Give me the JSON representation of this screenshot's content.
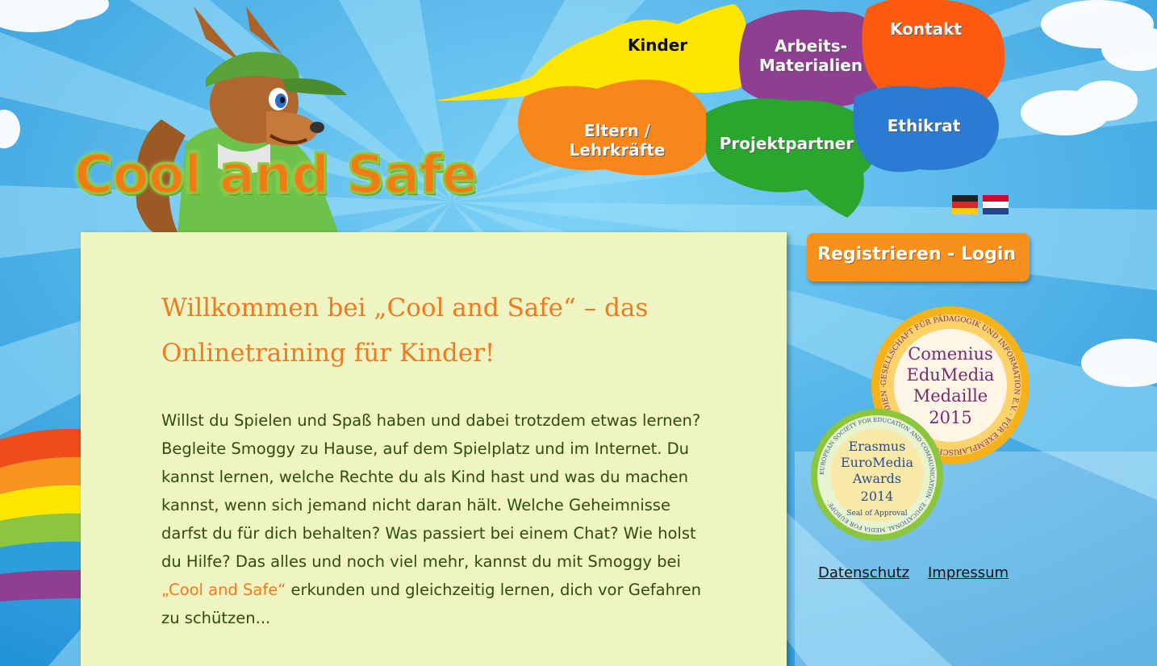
{
  "header": {
    "logo_text": "Cool and Safe"
  },
  "nav": {
    "kinder": "Kinder",
    "arbeitsmaterialien_line1": "Arbeits-",
    "arbeitsmaterialien_line2": "Materialien",
    "kontakt": "Kontakt",
    "eltern_line1": "Eltern /",
    "eltern_line2": "Lehrkräfte",
    "projektpartner": "Projektpartner",
    "ethikrat": "Ethikrat"
  },
  "main": {
    "title": "Willkommen bei „Cool and Safe“ – das Onlinetraining für Kinder!",
    "intro_before": "Willst du Spielen und Spaß haben und dabei trotzdem etwas lernen? Begleite Smoggy zu Hause, auf dem Spielplatz und im Internet. Du kannst lernen, welche Rechte du als Kind hast und was du machen kannst, wenn sich jemand nicht daran hält. Welche Geheimnisse darfst du für dich behalten? Was passiert bei einem Chat? Wie holst du Hilfe? Das alles und noch viel mehr, kannst du mit Smoggy bei ",
    "intro_link": "„Cool and Safe“",
    "intro_after": " erkunden und gleichzeitig lernen, dich vor Gefahren zu schützen..."
  },
  "sidebar": {
    "login_label": "Registrieren - Login",
    "award1_line1": "Comenius",
    "award1_line2": "EduMedia",
    "award1_line3": "Medaille",
    "award1_line4": "2015",
    "award1_ring": "GESELLSCHAFT FÜR PÄDAGOGIK UND INFORMATION E.V. · FÜR EXEMPLARISCHE BILDUNGSMEDIEN ·",
    "award2_line1": "Erasmus",
    "award2_line2": "EuroMedia",
    "award2_line3": "Awards",
    "award2_line4": "2014",
    "award2_seal": "Seal of Approval",
    "award2_ring": "EUROPEAN SOCIETY FOR EDUCATION AND COMMUNICATION · EDUCATIONAL MEDIA FOR EUROPE ·"
  },
  "footer": {
    "datenschutz": "Datenschutz",
    "impressum": "Impressum"
  },
  "colors": {
    "sky": "#33a9e6",
    "panel": "#eef5c2",
    "accent_orange": "#f07a1d",
    "body_text": "#2e4c12",
    "nav_kinder": "#ffe600",
    "nav_arbeits": "#8e3f91",
    "nav_kontakt": "#ff5a12",
    "nav_eltern": "#f7871a",
    "nav_projekt": "#2aa52e",
    "nav_ethikrat": "#2a7bd1"
  }
}
